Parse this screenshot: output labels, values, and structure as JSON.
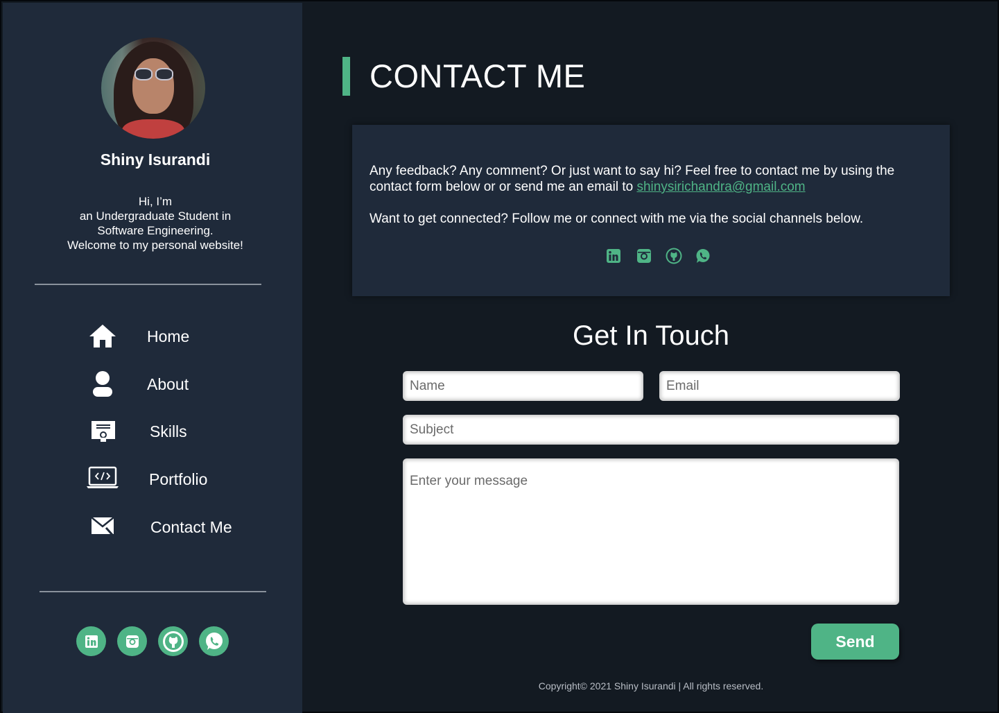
{
  "profile": {
    "name": "Shiny Isurandi",
    "bio": [
      "Hi, I’m",
      "an Undergraduate Student in",
      "Software Engineering.",
      "Welcome to my personal website!"
    ]
  },
  "nav": [
    {
      "label": "Home",
      "icon": "home-icon"
    },
    {
      "label": "About",
      "icon": "user-icon"
    },
    {
      "label": "Skills",
      "icon": "certificate-icon"
    },
    {
      "label": "Portfolio",
      "icon": "laptop-code-icon"
    },
    {
      "label": "Contact Me",
      "icon": "mail-icon"
    }
  ],
  "social_icons": [
    "linkedin-icon",
    "instagram-icon",
    "github-icon",
    "whatsapp-icon"
  ],
  "main": {
    "title": "CONTACT ME",
    "info_line1": "Any feedback? Any comment? Or just want to say hi? Feel free to contact me by using the",
    "info_line2_prefix": "contact  form below or or send me an email to ",
    "email": "shinysirichandra@gmail.com",
    "info_line3": "Want to get connected? Follow me or connect with me via the social channels below.",
    "section_title": "Get In Touch"
  },
  "form": {
    "name_placeholder": "Name",
    "email_placeholder": "Email",
    "subject_placeholder": "Subject",
    "message_placeholder": "Enter your message",
    "send_label": "Send"
  },
  "footer": {
    "copyright": "Copyright© 2021 Shiny Isurandi | All rights reserved."
  },
  "colors": {
    "accent": "#4fb486",
    "sidebar_bg": "#1f2a3a",
    "main_bg": "#131a22"
  }
}
